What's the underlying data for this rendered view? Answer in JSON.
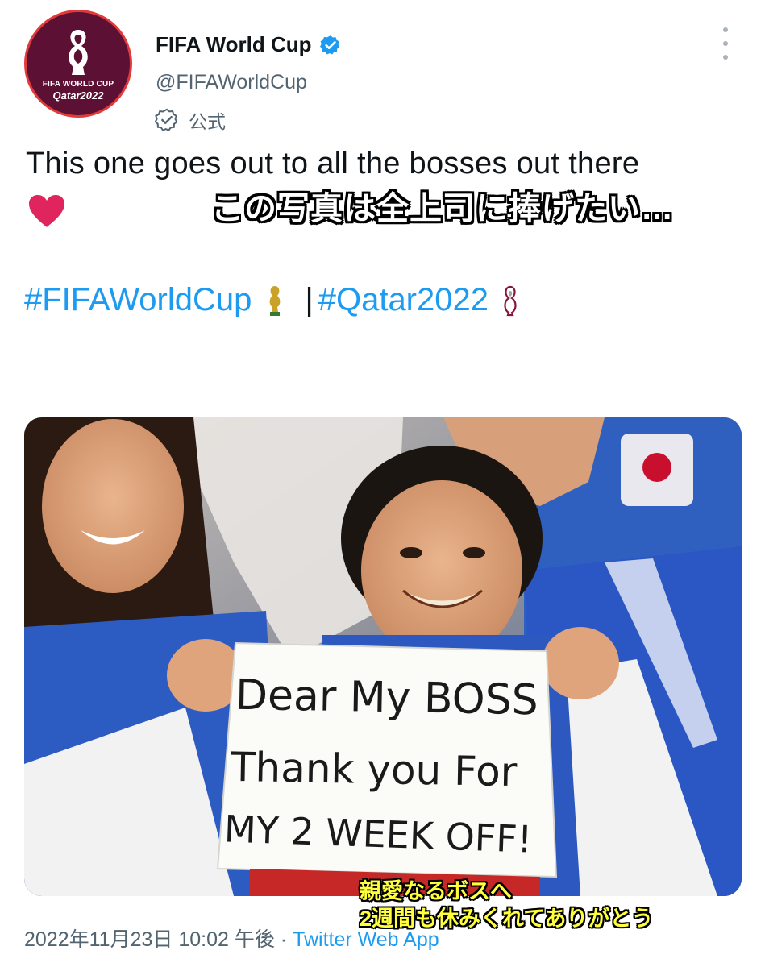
{
  "account": {
    "display_name": "FIFA World Cup",
    "handle": "@FIFAWorldCup",
    "official_label": "公式",
    "avatar_line1": "FIFA WORLD CUP",
    "avatar_line2": "Qatar2022"
  },
  "tweet": {
    "text": "This one goes out to all the bosses out there",
    "emoji": "heart",
    "caption_jp": "この写真は全上司に捧げたい…",
    "hashtag1": "#FIFAWorldCup",
    "separator": "|",
    "hashtag2": "#Qatar2022"
  },
  "photo": {
    "sign_line1": "Dear My BOSS",
    "sign_line2": "Thank you For",
    "sign_line3": "MY 2 WEEK OFF!",
    "subtitle_line1": "親愛なるボスへ",
    "subtitle_line2": "2週間も休みくれてありがとう"
  },
  "footer": {
    "timestamp": "2022年11月23日 10:02 午後",
    "dot": "·",
    "source": "Twitter Web App"
  },
  "colors": {
    "link": "#1d9bf0",
    "secondary_text": "#536471",
    "avatar_bg": "#5c1034",
    "subtitle_yellow": "#ffff3c"
  }
}
